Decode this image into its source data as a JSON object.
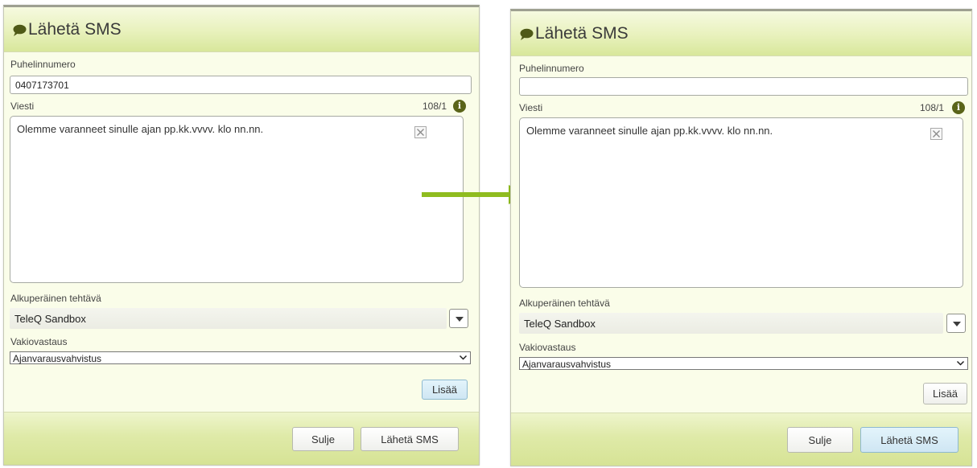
{
  "colors": {
    "accent": "#8fbc1f",
    "header": "#e8f1bc",
    "panel": "#fafde9"
  },
  "left": {
    "title": "Lähetä SMS",
    "phone_label": "Puhelinnumero",
    "phone_value": "0407173701",
    "message_label": "Viesti",
    "counter": "108/1",
    "message_text": "Olemme varanneet sinulle ajan pp.kk.vvvv. klo nn.nn.",
    "task_label": "Alkuperäinen tehtävä",
    "task_value": "TeleQ Sandbox",
    "template_label": "Vakiovastaus",
    "template_value": "Ajanvarausvahvistus",
    "add_button": "Lisää",
    "close_button": "Sulje",
    "send_button": "Lähetä SMS"
  },
  "right": {
    "title": "Lähetä SMS",
    "phone_label": "Puhelinnumero",
    "phone_value": "",
    "message_label": "Viesti",
    "counter": "108/1",
    "message_text": "Olemme varanneet sinulle ajan pp.kk.vvvv. klo nn.nn.",
    "task_label": "Alkuperäinen tehtävä",
    "task_value": "TeleQ Sandbox",
    "template_label": "Vakiovastaus",
    "template_value": "Ajanvarausvahvistus",
    "add_button": "Lisää",
    "close_button": "Sulje",
    "send_button": "Lähetä SMS"
  },
  "icons": {
    "title": "chat-bubble-icon",
    "info": "info-icon",
    "clear": "clear-icon",
    "dropdown": "chevron-down-icon",
    "transition": "arrow-right-icon"
  }
}
